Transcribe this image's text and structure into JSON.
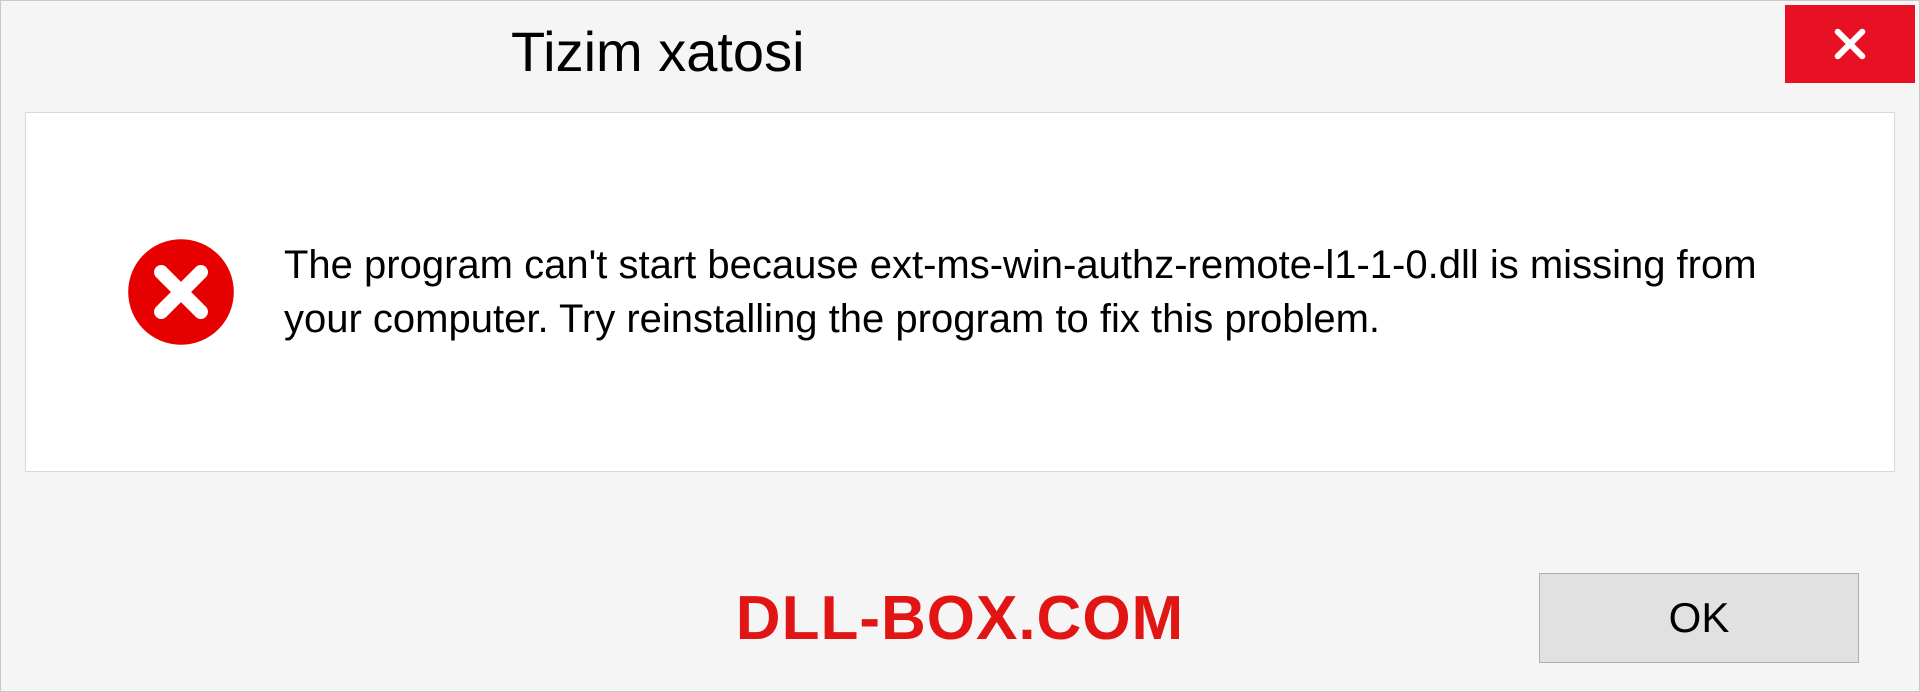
{
  "dialog": {
    "title": "Tizim xatosi",
    "message": "The program can't start because ext-ms-win-authz-remote-l1-1-0.dll is missing from your computer. Try reinstalling the program to fix this problem.",
    "ok_label": "OK"
  },
  "watermark": "DLL-BOX.COM"
}
